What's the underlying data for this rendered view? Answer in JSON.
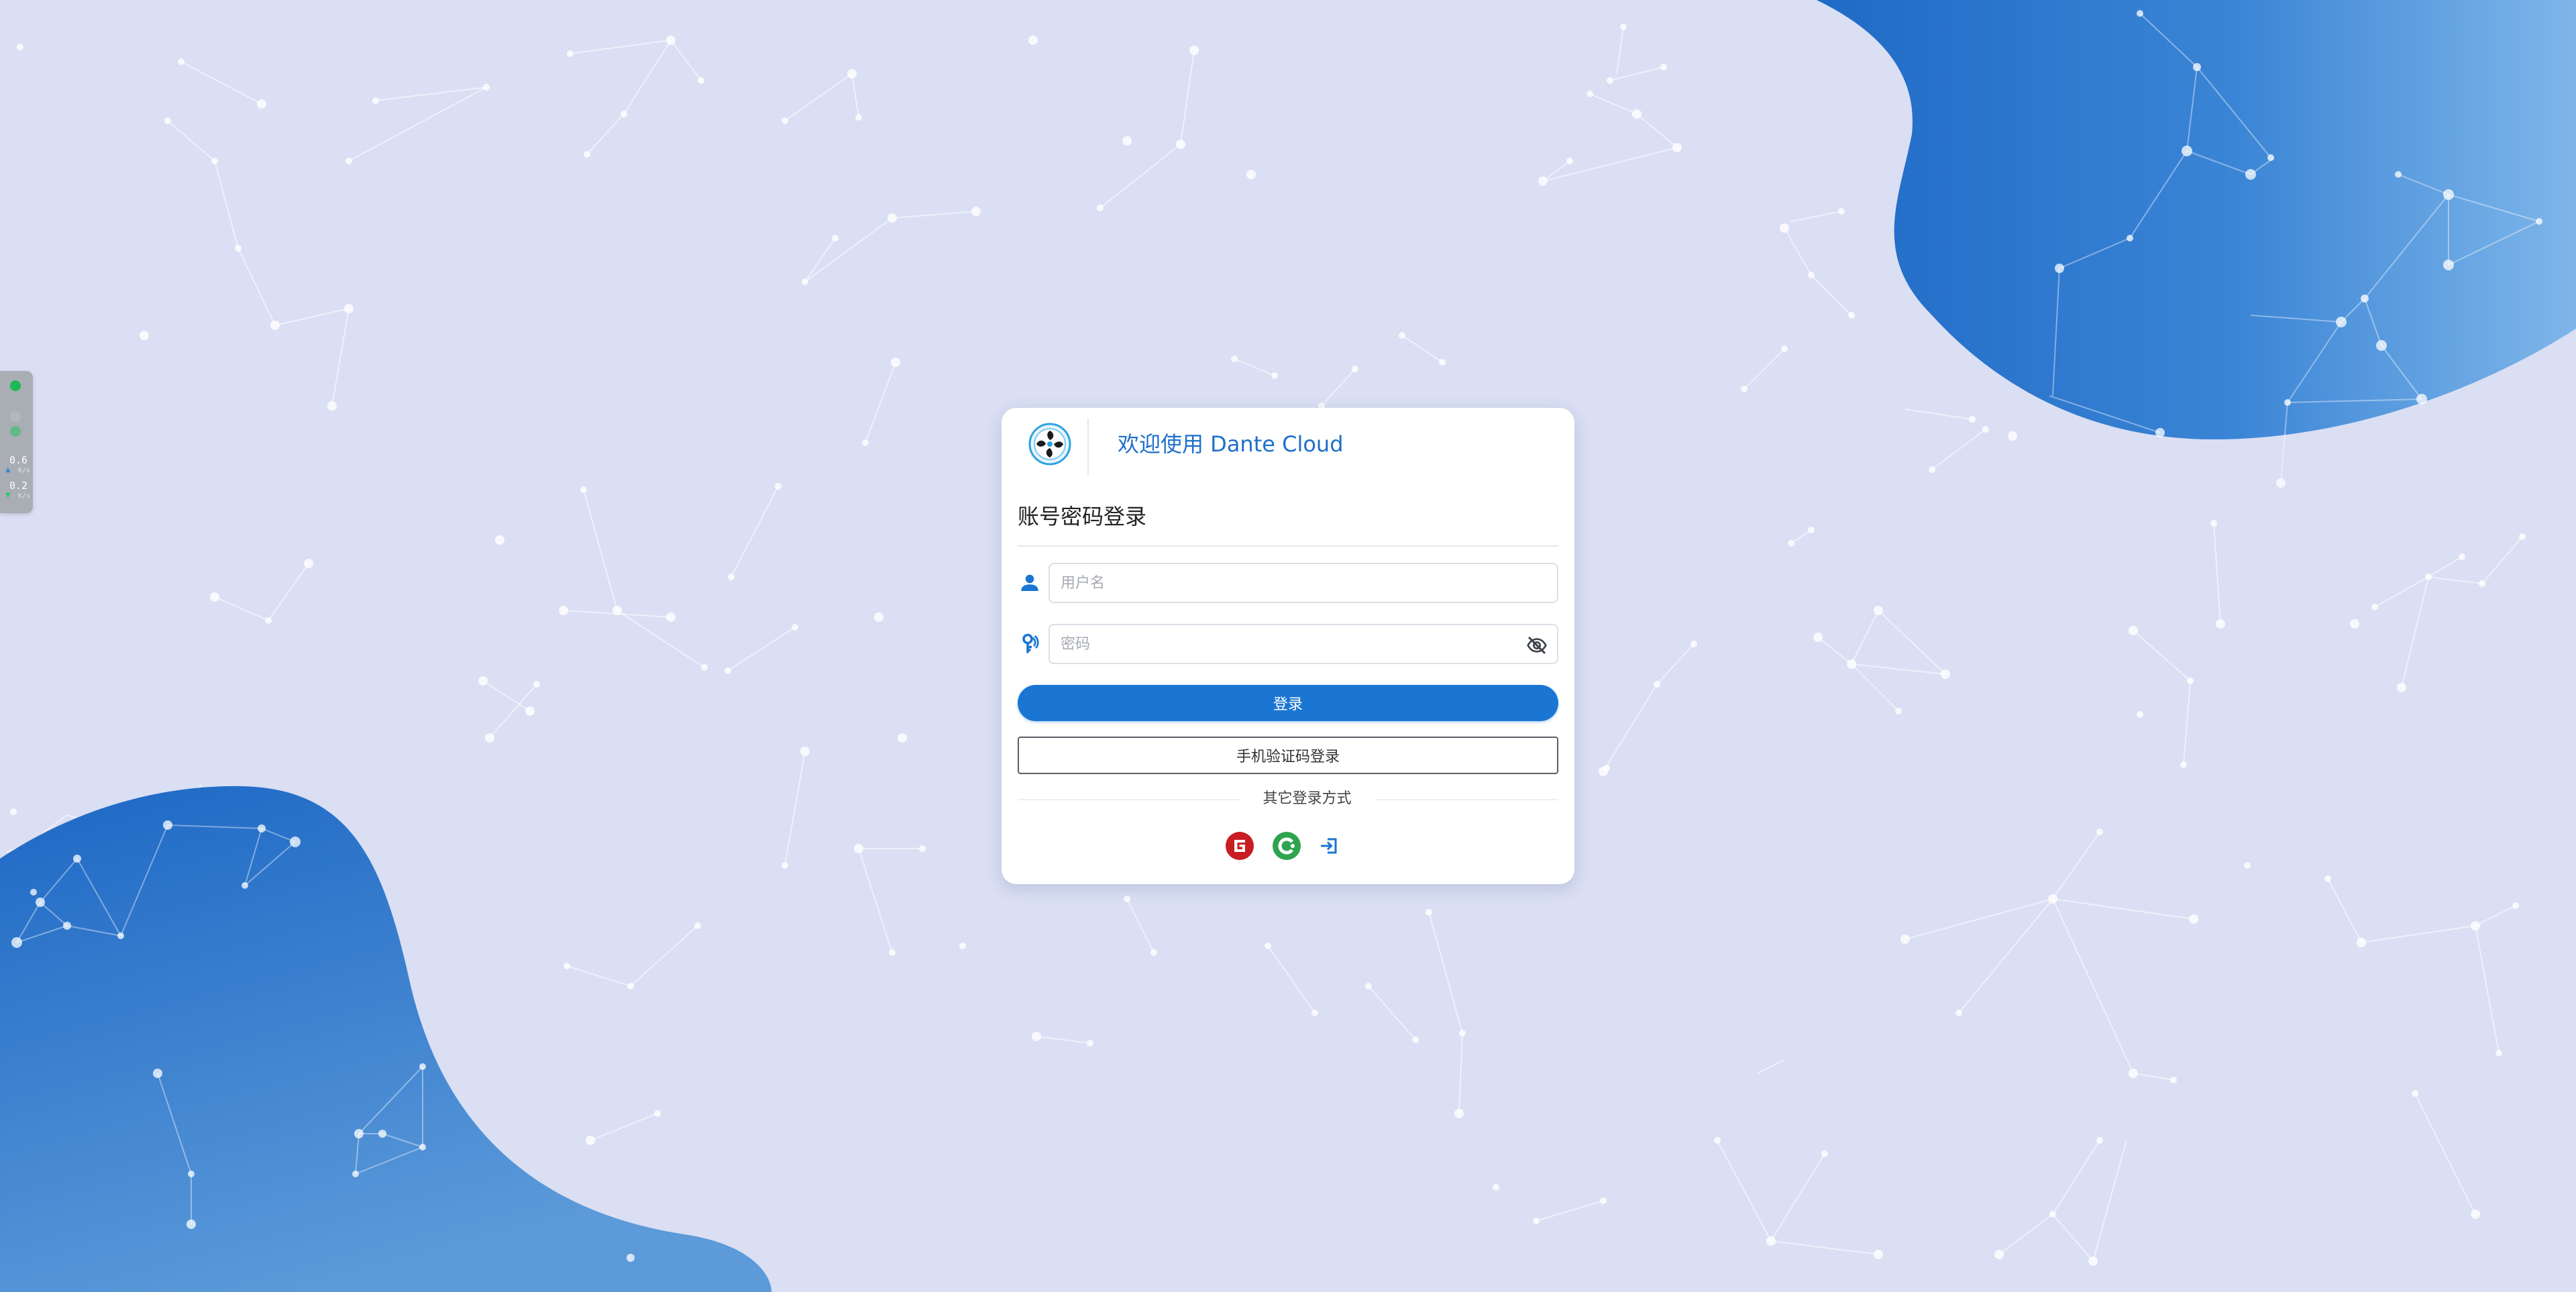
{
  "header": {
    "title": "欢迎使用 Dante Cloud"
  },
  "login": {
    "section_title": "账号密码登录",
    "username": {
      "value": "",
      "placeholder": "用户名",
      "icon": "user-icon"
    },
    "password": {
      "value": "",
      "placeholder": "密码",
      "icon": "key-icon",
      "toggle_icon": "eye-off-icon"
    },
    "submit_label": "登录",
    "sms_login_label": "手机验证码登录",
    "other_methods_label": "其它登录方式",
    "social": [
      {
        "name": "gitee",
        "icon": "gitee-icon",
        "color": "#c71d23"
      },
      {
        "name": "coding",
        "icon": "coding-icon",
        "color": "#2fa44f"
      },
      {
        "name": "sso",
        "icon": "login-arrow-icon",
        "color": "#1a76d2"
      }
    ]
  },
  "side_widget": {
    "items": [
      {
        "value": "0.6",
        "unit": "K/s"
      },
      {
        "value": "0.2",
        "unit": "K/s"
      }
    ]
  },
  "colors": {
    "background": "#dadff3",
    "accent": "#1a76d2",
    "blob": "#2a72cc"
  }
}
